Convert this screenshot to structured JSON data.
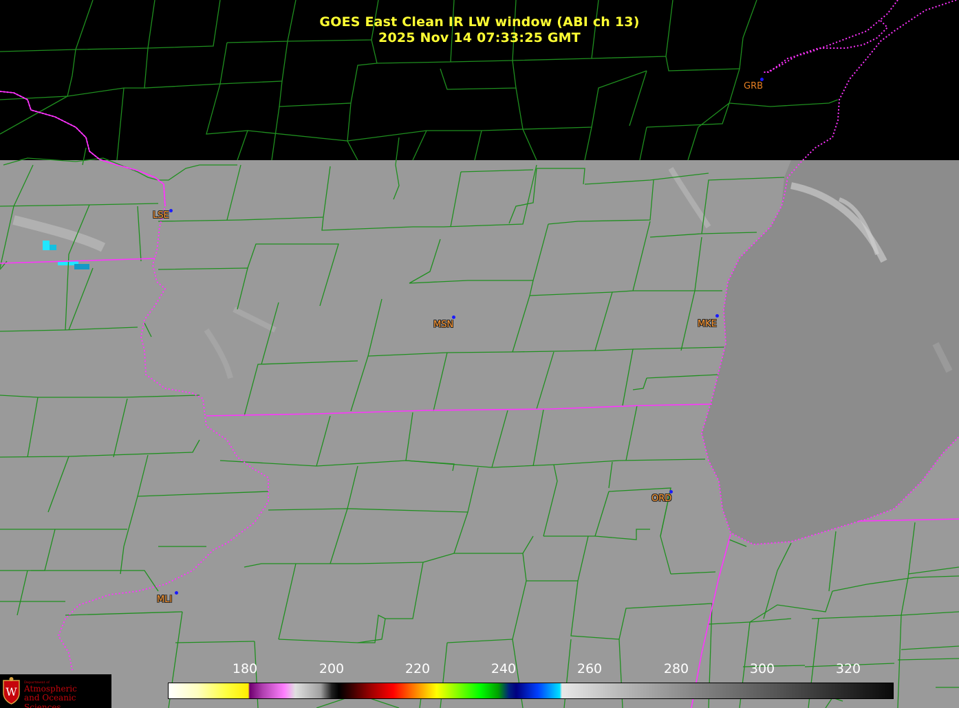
{
  "title": {
    "line1": "GOES East Clean IR LW window (ABI ch 13)",
    "line2": "2025 Nov 14  07:33:25 GMT"
  },
  "stations": [
    {
      "id": "GRB",
      "label": "GRB"
    },
    {
      "id": "LSE",
      "label": "LSE"
    },
    {
      "id": "MSN",
      "label": "MSN"
    },
    {
      "id": "MKE",
      "label": "MKE"
    },
    {
      "id": "ORD",
      "label": "ORD"
    },
    {
      "id": "MLI",
      "label": "MLI"
    }
  ],
  "colorbar": {
    "ticks": [
      "180",
      "200",
      "220",
      "240",
      "260",
      "280",
      "300",
      "320"
    ]
  },
  "logo": {
    "department_of": "Department of",
    "line1": "Atmospheric",
    "line2": "and Oceanic Sciences",
    "shield_letter": "W"
  },
  "colors": {
    "title": "#ffff33",
    "station_label": "#ff9933",
    "station_dot": "#1a1aff",
    "county_lines": "#1f8f1f",
    "state_lines": "#ff33ff",
    "imagery_gray": "#9a9a9a",
    "lake_gray": "#8c8c8c"
  }
}
